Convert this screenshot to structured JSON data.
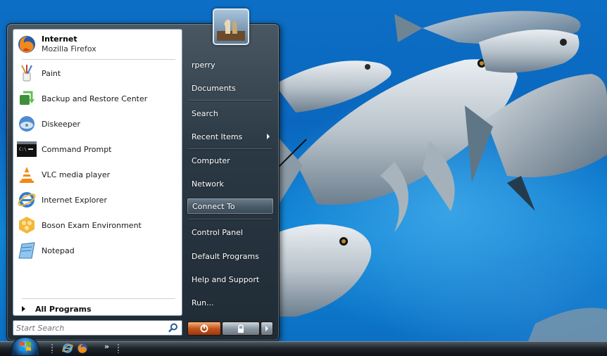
{
  "start_menu": {
    "pinned": [
      {
        "title": "Internet",
        "subtitle": "Mozilla Firefox",
        "icon": "firefox-icon"
      }
    ],
    "recent_programs": [
      {
        "label": "Paint",
        "icon": "paint-icon"
      },
      {
        "label": "Backup and Restore Center",
        "icon": "backup-restore-icon"
      },
      {
        "label": "Diskeeper",
        "icon": "diskeeper-icon"
      },
      {
        "label": "Command Prompt",
        "icon": "command-prompt-icon"
      },
      {
        "label": "VLC media player",
        "icon": "vlc-icon"
      },
      {
        "label": "Internet Explorer",
        "icon": "internet-explorer-icon"
      },
      {
        "label": "Boson Exam Environment",
        "icon": "boson-icon"
      },
      {
        "label": "Notepad",
        "icon": "notepad-icon"
      }
    ],
    "all_programs_label": "All Programs",
    "search_placeholder": "Start Search",
    "right_items": [
      {
        "label": "rperry"
      },
      {
        "label": "Documents"
      },
      {
        "label": "Search"
      },
      {
        "label": "Recent Items",
        "has_submenu": true
      },
      {
        "label": "Computer"
      },
      {
        "label": "Network"
      },
      {
        "label": "Connect To",
        "highlighted": true
      },
      {
        "label": "Control Panel"
      },
      {
        "label": "Default Programs"
      },
      {
        "label": "Help and Support"
      },
      {
        "label": "Run..."
      }
    ]
  },
  "taskbar": {
    "quick_launch": [
      "internet-explorer-icon",
      "firefox-icon"
    ],
    "overflow_label": "»"
  },
  "colors": {
    "menu_dark": "#1f2b35",
    "highlight": "#4b5c6a",
    "sleep_button": "#c3541d",
    "desktop_blue": "#0a67bf"
  }
}
